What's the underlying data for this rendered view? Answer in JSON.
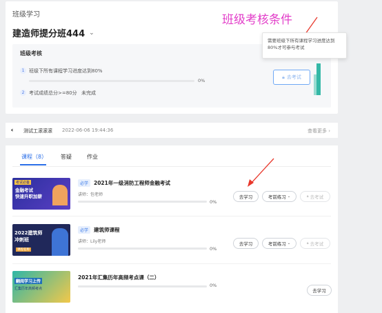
{
  "header": {
    "section_title": "班级学习",
    "class_name": "建造师提分班444",
    "annotation_title": "班级考核条件"
  },
  "exam": {
    "title": "班级考核",
    "conditions": [
      {
        "num": "1",
        "text": "班级下所有课程学习进度达到80%",
        "progress": "0%",
        "progress_value": 0
      },
      {
        "num": "2",
        "text": "考试成绩总分>=80分",
        "status": "未完成"
      }
    ],
    "button_label": "去考试",
    "tooltip": "需要班级下所有课程学习进度达到80%才可参与考试"
  },
  "notice": {
    "text": "测试工滚滚滚",
    "time": "2022-06-06 19:44:36",
    "more": "查看更多"
  },
  "tabs": [
    {
      "label": "课程（8）"
    },
    {
      "label": "答疑"
    },
    {
      "label": "作业"
    }
  ],
  "courses": [
    {
      "tag": "必学",
      "title": "2021年一级消防工程师金融考试",
      "teacher": "讲师：包老师",
      "progress": "0%",
      "progress_value": 0,
      "thumb_text": "金融考试\n快速升职加薪",
      "thumb_small": "考试必备",
      "buttons": {
        "study": "去学习",
        "practice": "考前练习",
        "exam": "去考试"
      }
    },
    {
      "tag": "必学",
      "title": "建筑师课程",
      "teacher": "讲师：Lily老师",
      "progress": "0%",
      "progress_value": 0,
      "thumb_text": "2022建筑师\n冲刺班",
      "thumb_small": "课程名称",
      "buttons": {
        "study": "去学习",
        "practice": "考前练习",
        "exam": "去考试"
      }
    },
    {
      "tag": "",
      "title": "2021年汇集历年高频考点课（二）",
      "teacher": "",
      "progress": "0%",
      "progress_value": 0,
      "thumb_text": "翻阅学习上传",
      "thumb_small": "汇集历年高频考点",
      "buttons": {
        "study": "去学习"
      }
    }
  ],
  "colors": {
    "accent": "#2a6ee8",
    "annotation": "#e23ec9",
    "teal": "#35b8a7",
    "arrow": "#e8382c"
  }
}
